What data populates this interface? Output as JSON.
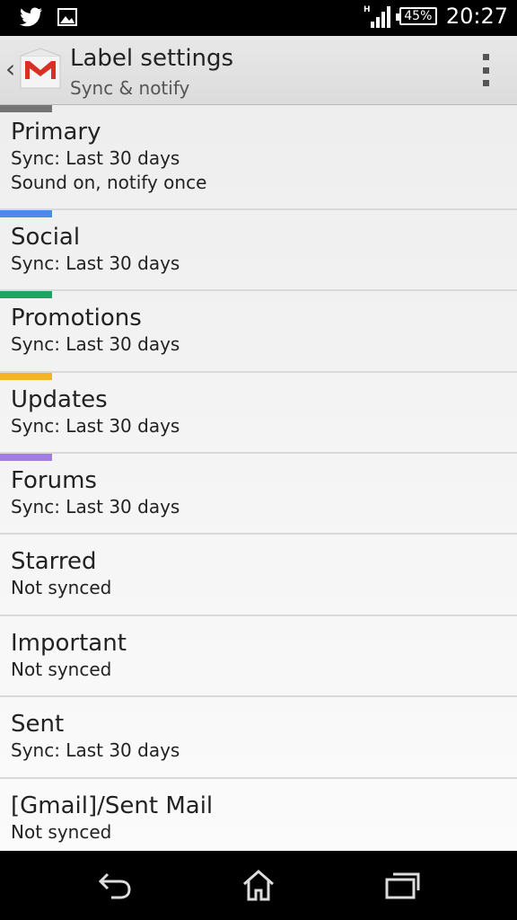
{
  "status_bar": {
    "icons": [
      "twitter-icon",
      "image-icon",
      "hspa-signal-icon",
      "battery-icon"
    ],
    "signal_label": "H",
    "battery": "45%",
    "time": "20:27"
  },
  "action_bar": {
    "title": "Label settings",
    "subtitle": "Sync & notify",
    "app_icon": "gmail-icon",
    "overflow_icon": "overflow-menu-icon",
    "up_icon": "back-caret-icon"
  },
  "labels": [
    {
      "name": "Primary",
      "details": [
        "Sync: Last 30 days",
        "Sound on, notify once"
      ],
      "color": "#757575"
    },
    {
      "name": "Social",
      "details": [
        "Sync: Last 30 days"
      ],
      "color": "#4a8be8"
    },
    {
      "name": "Promotions",
      "details": [
        "Sync: Last 30 days"
      ],
      "color": "#1ea362"
    },
    {
      "name": "Updates",
      "details": [
        "Sync: Last 30 days"
      ],
      "color": "#f2b51d"
    },
    {
      "name": "Forums",
      "details": [
        "Sync: Last 30 days"
      ],
      "color": "#a37ce0"
    },
    {
      "name": "Starred",
      "details": [
        "Not synced"
      ],
      "color": null
    },
    {
      "name": "Important",
      "details": [
        "Not synced"
      ],
      "color": null
    },
    {
      "name": "Sent",
      "details": [
        "Sync: Last 30 days"
      ],
      "color": null
    },
    {
      "name": "[Gmail]/Sent Mail",
      "details": [
        "Not synced"
      ],
      "color": null
    }
  ],
  "nav_bar": {
    "icons": [
      "back-icon",
      "home-icon",
      "recent-apps-icon"
    ]
  }
}
